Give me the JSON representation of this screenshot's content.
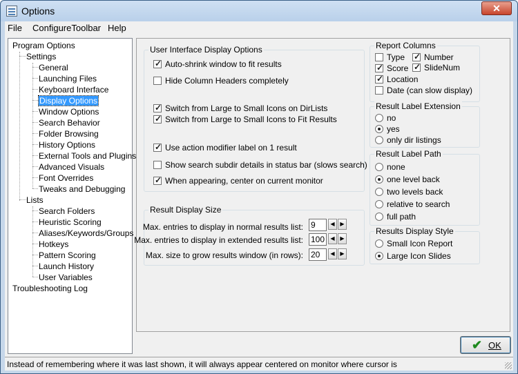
{
  "window": {
    "title": "Options",
    "close_label": "✕"
  },
  "menu": [
    "File",
    "ConfigureToolbar",
    "Help"
  ],
  "tree": {
    "root": "Program Options",
    "settings": "Settings",
    "settings_items": [
      "General",
      "Launching Files",
      "Keyboard Interface",
      "Display Options",
      "Window Options",
      "Search Behavior",
      "Folder Browsing",
      "History Options",
      "External Tools and Plugins",
      "Advanced Visuals",
      "Font Overrides",
      "Tweaks and Debugging"
    ],
    "selected": "Display Options",
    "lists": "Lists",
    "lists_items": [
      "Search Folders",
      "Heuristic Scoring",
      "Aliases/Keywords/Groups",
      "Hotkeys",
      "Pattern Scoring",
      "Launch History",
      "User Variables"
    ],
    "troubleshooting": "Troubleshooting Log"
  },
  "ui_display": {
    "title": "User Interface Display Options",
    "options": [
      {
        "label": "Auto-shrink window to fit results",
        "checked": true
      },
      {
        "label": "Hide Column Headers completely",
        "checked": false
      },
      {
        "label": "Switch from Large to Small Icons on DirLists",
        "checked": true
      },
      {
        "label": "Switch from Large to Small Icons to Fit Results",
        "checked": true
      },
      {
        "label": "Use action modifier label on 1 result",
        "checked": true
      },
      {
        "label": "Show search subdir details in status bar (slows search)",
        "checked": false
      },
      {
        "label": "When appearing, center on current monitor",
        "checked": true
      }
    ]
  },
  "result_size": {
    "title": "Result Display Size",
    "fields": [
      {
        "label": "Max. entries to display in normal results list:",
        "value": "9"
      },
      {
        "label": "Max. entries to display in extended results list:",
        "value": "100"
      },
      {
        "label": "Max. size to grow results window (in rows):",
        "value": "20"
      }
    ]
  },
  "report_columns": {
    "title": "Report Columns",
    "items": [
      {
        "label": "Type",
        "checked": false
      },
      {
        "label": "Number",
        "checked": true
      },
      {
        "label": "Score",
        "checked": true
      },
      {
        "label": "SlideNum",
        "checked": true
      },
      {
        "label": "Location",
        "checked": true
      },
      {
        "label": "Date (can slow display)",
        "checked": false
      }
    ]
  },
  "label_extension": {
    "title": "Result Label Extension",
    "options": [
      "no",
      "yes",
      "only dir listings"
    ],
    "selected": "yes"
  },
  "label_path": {
    "title": "Result Label Path",
    "options": [
      "none",
      "one level back",
      "two levels back",
      "relative to search",
      "full path"
    ],
    "selected": "one level back"
  },
  "display_style": {
    "title": "Results Display Style",
    "options": [
      "Small Icon Report",
      "Large Icon Slides"
    ],
    "selected": "Large Icon Slides"
  },
  "ok_label": "OK",
  "status": "Instead of remembering where it was last shown, it will always appear centered on monitor where cursor is"
}
